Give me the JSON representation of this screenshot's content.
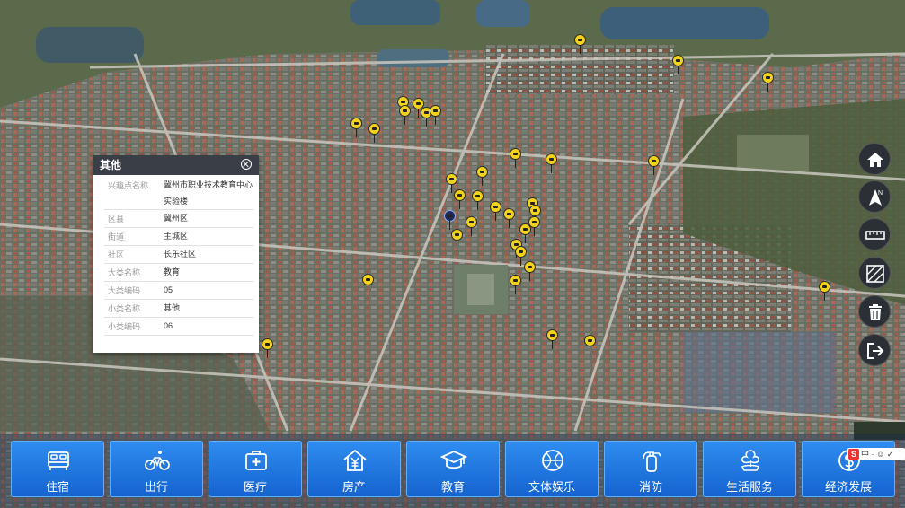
{
  "info_panel": {
    "title": "其他",
    "rows": [
      {
        "key": "兴趣点名称",
        "value": "冀州市职业技术教育中心实验楼"
      },
      {
        "key": "区县",
        "value": "冀州区"
      },
      {
        "key": "街道",
        "value": "主城区"
      },
      {
        "key": "社区",
        "value": "长乐社区"
      },
      {
        "key": "大类名称",
        "value": "教育"
      },
      {
        "key": "大类编码",
        "value": "05"
      },
      {
        "key": "小类名称",
        "value": "其他"
      },
      {
        "key": "小类编码",
        "value": "06"
      }
    ]
  },
  "right_toolbar": [
    {
      "icon": "home-icon"
    },
    {
      "icon": "compass-icon"
    },
    {
      "icon": "ruler-icon"
    },
    {
      "icon": "area-measure-icon"
    },
    {
      "icon": "trash-icon"
    },
    {
      "icon": "exit-icon"
    }
  ],
  "bottom_nav": [
    {
      "label": "住宿",
      "icon": "bed-icon"
    },
    {
      "label": "出行",
      "icon": "bicycle-icon"
    },
    {
      "label": "医疗",
      "icon": "medical-kit-icon"
    },
    {
      "label": "房产",
      "icon": "house-yuan-icon"
    },
    {
      "label": "教育",
      "icon": "graduation-cap-icon"
    },
    {
      "label": "文体娱乐",
      "icon": "ball-icon"
    },
    {
      "label": "消防",
      "icon": "fire-extinguisher-icon"
    },
    {
      "label": "生活服务",
      "icon": "flower-hand-icon"
    },
    {
      "label": "经济发展",
      "icon": "dollar-coin-icon"
    }
  ],
  "ime": {
    "badge": "S",
    "text": "中 · ☺ ✓"
  },
  "colors": {
    "nav_blue": "#1e75e0",
    "marker_yellow": "#f2d21b",
    "panel_header": "#3a3f47"
  }
}
